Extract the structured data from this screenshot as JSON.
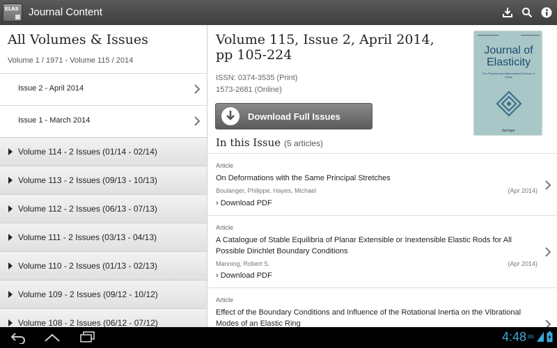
{
  "app": {
    "logo_text": "ELAS",
    "title": "Journal Content"
  },
  "actions": {
    "download_icon": "download-icon",
    "search_icon": "search-icon",
    "info_icon": "info-icon"
  },
  "left": {
    "title": "All Volumes & Issues",
    "range": "Volume 1 / 1971 - Volume 115 / 2014",
    "issues": [
      {
        "label": "Issue 2 - April 2014"
      },
      {
        "label": "Issue 1 - March 2014"
      }
    ],
    "volumes": [
      {
        "label": "Volume 114 - 2 Issues (01/14  -  02/14)"
      },
      {
        "label": "Volume 113 - 2 Issues (09/13  -  10/13)"
      },
      {
        "label": "Volume 112 - 2 Issues (06/13  -  07/13)"
      },
      {
        "label": "Volume 111 - 2 Issues (03/13  -  04/13)"
      },
      {
        "label": "Volume 110 - 2 Issues (01/13  -  02/13)"
      },
      {
        "label": "Volume 109 - 2 Issues (09/12  -  10/12)"
      },
      {
        "label": "Volume 108 - 2 Issues (06/12  -  07/12)"
      }
    ]
  },
  "detail": {
    "title": "Volume 115, Issue 2, April 2014, pp 105-224",
    "issn_print": "ISSN: 0374-3535 (Print)",
    "issn_online": "1573-2681 (Online)",
    "download_button": "Download Full Issues",
    "in_issue_label": "In this Issue",
    "article_count": "(5 articles)",
    "cover": {
      "journal_name": "Journal of Elasticity",
      "subtitle": "The Physical and Mathematical Science of Solids",
      "publisher": "Springer",
      "color": "#a9c7c7"
    },
    "articles": [
      {
        "type": "Article",
        "title": "On Deformations with the Same Principal Stretches",
        "authors": "Boulanger, Philippe, Hayes, Michael",
        "date": "(Apr 2014)",
        "pdf": "Download PDF"
      },
      {
        "type": "Article",
        "title": "A Catalogue of Stable Equilibria of Planar Extensible or Inextensible Elastic Rods for All Possible Dirichlet Boundary Conditions",
        "authors": "Manning, Robert S.",
        "date": "(Apr 2014)",
        "pdf": "Download PDF"
      },
      {
        "type": "Article",
        "title": "Effect of the Boundary Conditions and Influence of the Rotational Inertia on the Vibrational Modes of an Elastic Ring",
        "authors": "",
        "date": "",
        "pdf": ""
      }
    ]
  },
  "status": {
    "clock": "4:48",
    "network": "3G",
    "accent": "#3aa9d8"
  }
}
